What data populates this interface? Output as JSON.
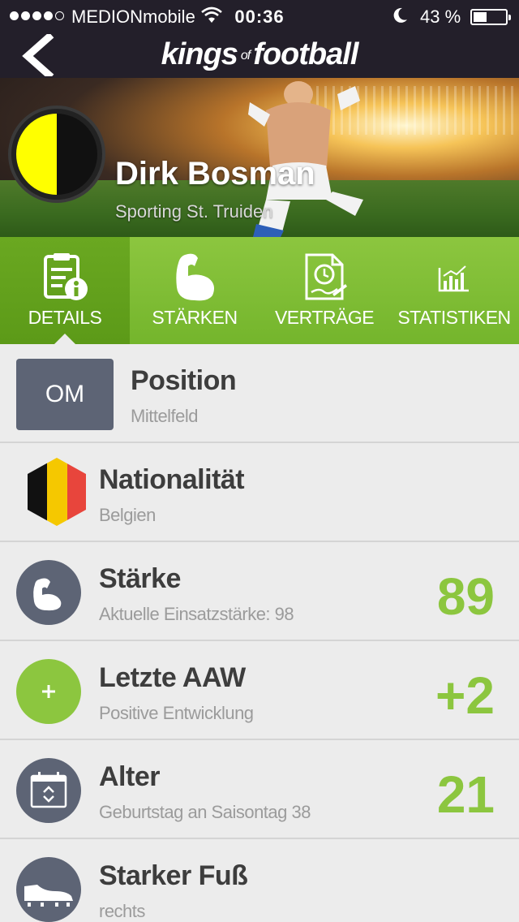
{
  "status_bar": {
    "carrier": "MEDIONmobile",
    "time": "00:36",
    "battery_percent": "43 %",
    "battery_level": 0.43,
    "signal_bars": 4
  },
  "nav": {
    "logo_part1": "kings",
    "logo_part2": "of",
    "logo_part3": "football",
    "back_icon": "chevron-left-icon"
  },
  "hero": {
    "player_name": "Dirk Bosman",
    "club_name": "Sporting St. Truiden",
    "club_colors": [
      "#ffff00",
      "#111111"
    ]
  },
  "tabs": [
    {
      "label": "DETAILS",
      "icon": "clipboard-info-icon",
      "active": true
    },
    {
      "label": "STÄRKEN",
      "icon": "flexed-arm-icon",
      "active": false
    },
    {
      "label": "VERTRÄGE",
      "icon": "contract-icon",
      "active": false
    },
    {
      "label": "STATISTIKEN",
      "icon": "bar-chart-icon",
      "active": false
    }
  ],
  "details": {
    "position": {
      "badge": "OM",
      "title": "Position",
      "subtitle": "Mittelfeld"
    },
    "nationality": {
      "title": "Nationalität",
      "subtitle": "Belgien",
      "flag_colors": [
        "#111111",
        "#f5c800",
        "#e8453c"
      ]
    },
    "strength": {
      "title": "Stärke",
      "subtitle": "Aktuelle Einsatzstärke: 98",
      "value": "89",
      "icon": "flexed-arm-icon"
    },
    "last_aaw": {
      "title": "Letzte AAW",
      "subtitle": "Positive Entwicklung",
      "value": "+2",
      "icon": "plus-icon"
    },
    "age": {
      "title": "Alter",
      "subtitle": "Geburtstag an Saisontag 38",
      "value": "21",
      "icon": "calendar-icon"
    },
    "foot": {
      "title": "Starker Fuß",
      "subtitle": "rechts",
      "icon": "football-boot-icon"
    }
  },
  "colors": {
    "accent_green": "#8cc63f",
    "dark_bar": "#231f2a",
    "icon_slate": "#5d6475"
  }
}
